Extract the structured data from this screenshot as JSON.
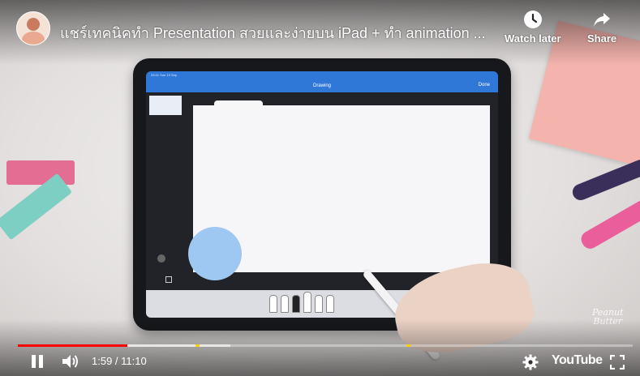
{
  "video": {
    "title": "แชร์เทคนิคทำ Presentation สวยและง่ายบน iPad + ทำ animation ...",
    "current_time": "1:59",
    "duration": "11:10",
    "time_display": "1:59 / 11:10",
    "progress_played_fraction": 0.178,
    "progress_buffered_fraction": 0.345,
    "chapter_marker_fractions": [
      0.289,
      0.632
    ]
  },
  "top_actions": {
    "watch_later": {
      "label": "Watch later",
      "icon": "clock-icon"
    },
    "share": {
      "label": "Share",
      "icon": "share-arrow-icon"
    }
  },
  "controls": {
    "play_pause_icon": "pause-icon",
    "volume_icon": "volume-icon",
    "settings_icon": "gear-icon",
    "youtube_label": "YouTube",
    "fullscreen_icon": "fullscreen-icon",
    "progress_color": "#ff0000"
  },
  "ipad_app": {
    "status_time": "09:41  Sun 19 Sep",
    "screen_title": "Drawing",
    "done_label": "Done",
    "accent_color": "#2f78d8"
  },
  "watermark": {
    "line1": "Peanut",
    "line2": "Butter"
  }
}
